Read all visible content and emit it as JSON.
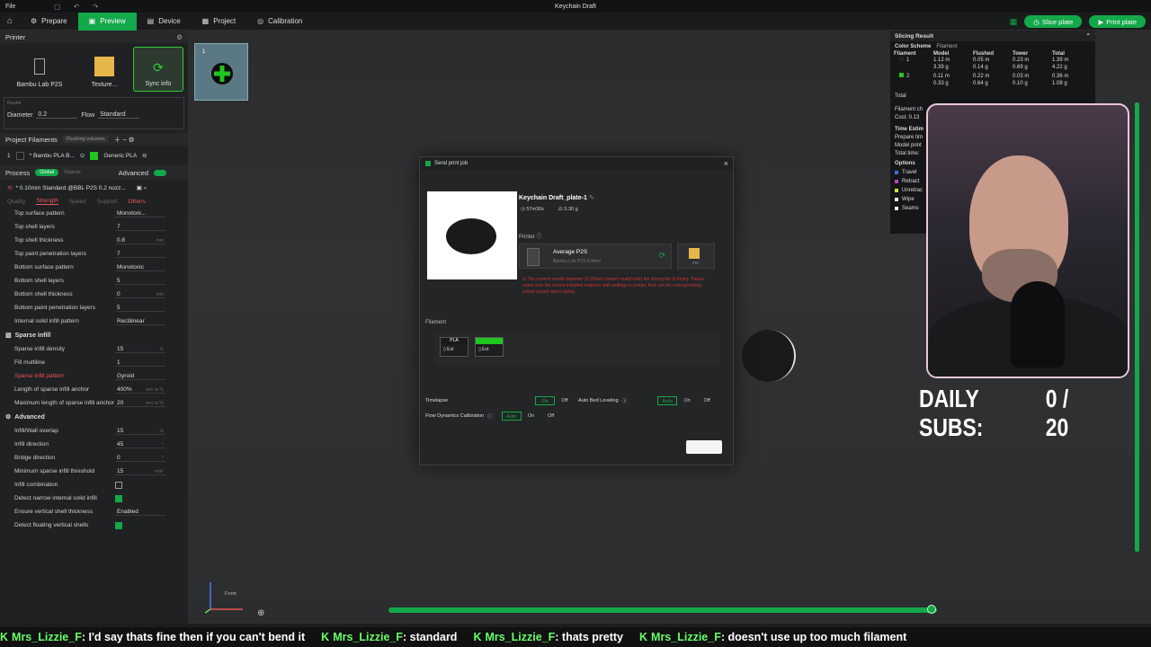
{
  "window": {
    "title": "Keychain Draft",
    "file_menu": "File"
  },
  "nav": {
    "tabs": [
      "Prepare",
      "Preview",
      "Device",
      "Project",
      "Calibration"
    ],
    "active": "Preview",
    "slice_label": "Slice plate",
    "print_label": "Print plate"
  },
  "left": {
    "printer_head": "Printer",
    "printer_name": "Bambu Lab P2S",
    "texture_label": "Texture...",
    "sync_label": "Sync info",
    "nozzle_label": "Nozzle",
    "diameter_label": "Diameter",
    "diameter_value": "0.2",
    "flow_label": "Flow",
    "flow_value": "Standard",
    "project_filaments": "Project Filaments",
    "flushing": "Flushing volumes",
    "filaments": [
      {
        "idx": "1",
        "name": "* Bambu PLA B...",
        "color": "#1f1f1f",
        "type": "Generic PLA",
        "type_color": "#21c521"
      }
    ],
    "process": "Process",
    "global_label": "Global",
    "objects_label": "Objects",
    "advanced_label": "Advanced",
    "preset": "* 0.10mm Standard @BBL P2S 0.2 nozz...",
    "tabs": [
      "Quality",
      "Strength",
      "Speed",
      "Support",
      "Others"
    ],
    "rows_shell": [
      {
        "k": "Top surface pattern",
        "v": "Monotoni..."
      },
      {
        "k": "Top shell layers",
        "v": "7"
      },
      {
        "k": "Top shell thickness",
        "v": "0.8",
        "u": "mm"
      },
      {
        "k": "Top paint penetration layers",
        "v": "7"
      },
      {
        "k": "Bottom surface pattern",
        "v": "Monotonic"
      },
      {
        "k": "Bottom shell layers",
        "v": "5"
      },
      {
        "k": "Bottom shell thickness",
        "v": "0",
        "u": "mm"
      },
      {
        "k": "Bottom paint penetration layers",
        "v": "5"
      },
      {
        "k": "Internal solid infill pattern",
        "v": "Rectilinear"
      }
    ],
    "sparse_head": "Sparse infill",
    "rows_sparse": [
      {
        "k": "Sparse infill density",
        "v": "15",
        "u": "%"
      },
      {
        "k": "Fill multiline",
        "v": "1"
      },
      {
        "k": "Sparse infill pattern",
        "v": "Gyroid",
        "warn": true
      },
      {
        "k": "Length of sparse infill anchor",
        "v": "400%",
        "u": "mm or %"
      },
      {
        "k": "Maximum length of sparse infill anchor",
        "v": "20",
        "u": "mm or %"
      }
    ],
    "advanced_head": "Advanced",
    "rows_adv": [
      {
        "k": "Infill/Wall overlap",
        "v": "15",
        "u": "%"
      },
      {
        "k": "Infill direction",
        "v": "45",
        "u": "°"
      },
      {
        "k": "Bridge direction",
        "v": "0",
        "u": "°"
      },
      {
        "k": "Minimum sparse infill threshold",
        "v": "15",
        "u": "mm²"
      },
      {
        "k": "Infill combination",
        "chk": false
      },
      {
        "k": "Detect narrow internal solid infill",
        "chk": true
      },
      {
        "k": "Ensure vertical shell thickness",
        "v": "Enabled"
      },
      {
        "k": "Detect floating vertical shells",
        "chk": true
      }
    ]
  },
  "plate": {
    "number": "1"
  },
  "view": {
    "front_label": "Front"
  },
  "slicing": {
    "title": "Slicing Result",
    "color_scheme": "Color Scheme",
    "scheme_value": "Filament",
    "headers": [
      "Filament",
      "Model",
      "Flushed",
      "Tower",
      "Total"
    ],
    "rows": [
      {
        "id": "1",
        "color": "#222222",
        "model": [
          "1.12 m",
          "3.39 g"
        ],
        "flushed": [
          "0.05 m",
          "0.14 g"
        ],
        "tower": [
          "0.23 m",
          "0.69 g"
        ],
        "total": [
          "1.39 m",
          "4.22 g"
        ]
      },
      {
        "id": "2",
        "color": "#21c521",
        "model": [
          "0.11 m",
          "0.33 g"
        ],
        "flushed": [
          "0.22 m",
          "0.64 g"
        ],
        "tower": [
          "0.03 m",
          "0.10 g"
        ],
        "total": [
          "0.36 m",
          "1.08 g"
        ]
      }
    ],
    "total_label": "Total",
    "filament_change": "Filament ch",
    "cost": "Cost: 0.13",
    "time_est": "Time Estim",
    "prepare_time": "Prepare tim",
    "model_print": "Model print",
    "total_time": "Total time:",
    "options": "Options",
    "option_items": [
      {
        "label": "Travel",
        "color": "#3b6fe0"
      },
      {
        "label": "Retract",
        "color": "#c040c0"
      },
      {
        "label": "Unretrac",
        "color": "#d8d840"
      },
      {
        "label": "Wipe",
        "color": "#e8e8e8"
      },
      {
        "label": "Seams",
        "color": "#f0f0f0"
      }
    ]
  },
  "overlay": {
    "daily_subs_label": "DAILY SUBS:",
    "daily_subs_value": "0 / 20"
  },
  "dialog": {
    "title": "Send print job",
    "job_name": "Keychain Draft_plate-1",
    "time": "57m30s",
    "weight": "5.30 g",
    "printer_label": "Printer",
    "printer_name": "Average P2S",
    "printer_sub": "Bambu Lab P2S  0.4mm",
    "pei_label": "PEI",
    "warning": "The current nozzle diameter (0.20mm) doesn't match with the slicing file (0.4mm). Please make sure the nozzle installed matches with settings in printer, then set the corresponding printer preset when slicing.",
    "filament_label": "Filament",
    "fil_chips": [
      {
        "top": "PLA",
        "bot": "Ext",
        "top_color": "#1a1a1a"
      },
      {
        "top": "",
        "bot": "Ext",
        "top_color": "#21c521"
      }
    ],
    "timelapse": "Timelapse",
    "auto_bed": "Auto Bed Leveling",
    "flow_cal": "Flow Dynamics Calibration",
    "on": "On",
    "off": "Off",
    "auto": "Auto"
  },
  "ticker": [
    {
      "user": "Mrs_Lizzie_F",
      "msg": ": I'd say thats fine then if you can't bend it"
    },
    {
      "user": "Mrs_Lizzie_F",
      "msg": ": standard"
    },
    {
      "user": "Mrs_Lizzie_F",
      "msg": ": thats pretty"
    },
    {
      "user": "Mrs_Lizzie_F",
      "msg": ": doesn't use up too much filament"
    }
  ],
  "colors": {
    "accent": "#13a849",
    "warn": "#e55555"
  }
}
